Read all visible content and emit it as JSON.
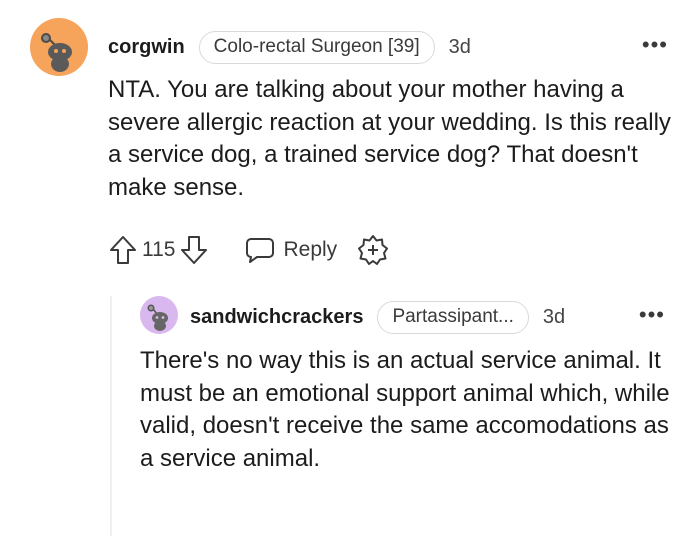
{
  "comments": [
    {
      "username": "corgwin",
      "flair": "Colo-rectal Surgeon [39]",
      "time": "3d",
      "more": "•••",
      "body": "NTA. You are talking about your mother having a severe allergic reaction at your wedding. Is this really a service dog, a trained service dog? That doesn't make sense.",
      "score": "115",
      "reply_label": "Reply",
      "avatar_color": "#f6a35c"
    },
    {
      "username": "sandwichcrackers",
      "flair": "Partassipant...",
      "time": "3d",
      "more": "•••",
      "body": "There's no way this is an actual service animal. It must be an emotional support animal which, while valid, doesn't receive the same accomodations as a service animal.",
      "avatar_color": "#d9b8f0"
    }
  ]
}
